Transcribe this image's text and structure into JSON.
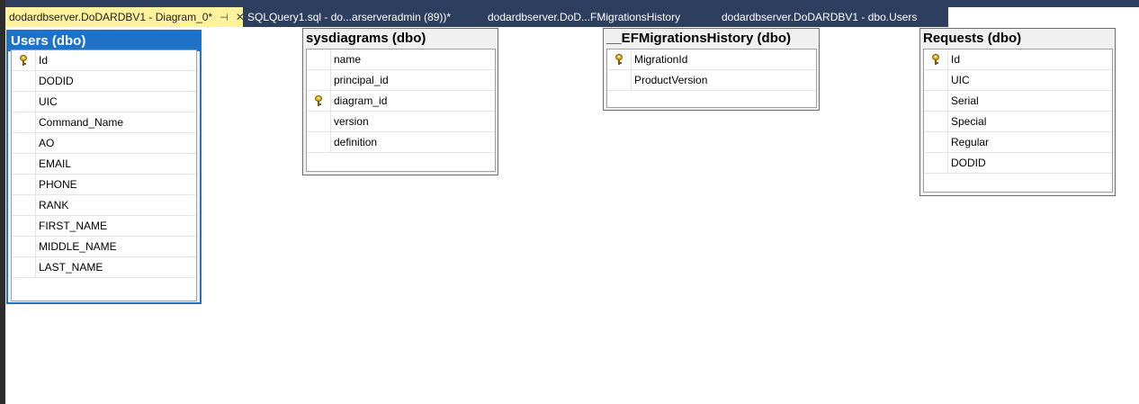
{
  "tabs": [
    {
      "label": "dodardbserver.DoDARDBV1 - Diagram_0*",
      "active": true
    },
    {
      "label": "SQLQuery1.sql - do...arserveradmin (89))*",
      "active": false
    },
    {
      "label": "dodardbserver.DoD...FMigrationsHistory",
      "active": false
    },
    {
      "label": "dodardbserver.DoDARDBV1 - dbo.Users",
      "active": false
    }
  ],
  "tab_pin_icon": "pin-icon",
  "tab_close_icon": "close-icon",
  "tables": {
    "users": {
      "title": "Users (dbo)",
      "selected": true,
      "columns": [
        "Id",
        "DODID",
        "UIC",
        "Command_Name",
        "AO",
        "EMAIL",
        "PHONE",
        "RANK",
        "FIRST_NAME",
        "MIDDLE_NAME",
        "LAST_NAME"
      ],
      "primary_key": "Id"
    },
    "sysdiagrams": {
      "title": "sysdiagrams (dbo)",
      "selected": false,
      "columns": [
        "name",
        "principal_id",
        "diagram_id",
        "version",
        "definition"
      ],
      "primary_key": "diagram_id"
    },
    "migrations": {
      "title": "__EFMigrationsHistory (dbo)",
      "selected": false,
      "columns": [
        "MigrationId",
        "ProductVersion"
      ],
      "primary_key": "MigrationId"
    },
    "requests": {
      "title": "Requests (dbo)",
      "selected": false,
      "columns": [
        "Id",
        "UIC",
        "Serial",
        "Special",
        "Regular",
        "DODID"
      ],
      "primary_key": "Id"
    }
  },
  "colors": {
    "selection_blue": "#1e73c8",
    "active_tab": "#fff29d",
    "tab_bar": "#2d3e5f",
    "key_gold": "#e2b51d"
  }
}
